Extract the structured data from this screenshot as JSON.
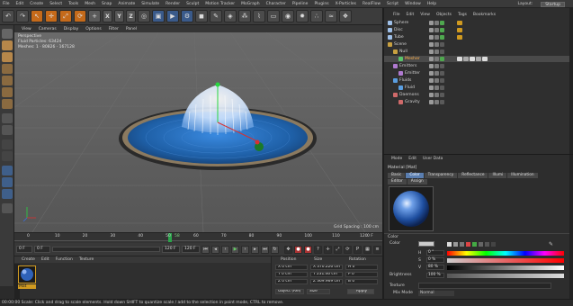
{
  "menubar": {
    "items": [
      "File",
      "Edit",
      "Create",
      "Select",
      "Tools",
      "Mesh",
      "Snap",
      "Animate",
      "Simulate",
      "Render",
      "Sculpt",
      "Motion Tracker",
      "MoGraph",
      "Character",
      "Pipeline",
      "Plugins",
      "X-Particles",
      "RealFlow",
      "Script",
      "Window",
      "Help"
    ],
    "layout_label": "Layout:",
    "layout_value": "Startup"
  },
  "toolbar": {
    "undo_glyph": "↶",
    "axis_labels": [
      "X",
      "Y",
      "Z"
    ],
    "glyphs": [
      "↖",
      "✛",
      "⤢",
      "⟳"
    ]
  },
  "viewport": {
    "menu": [
      "View",
      "Cameras",
      "Display",
      "Options",
      "Filter",
      "Panel"
    ],
    "camera_label": "Perspective",
    "stats": [
      "Fluid Particles: 63424",
      "Meshes: 1 · 80826 · 167128"
    ],
    "grid_spacing": "Grid Spacing : 100 cm",
    "colors": {
      "floor": "#5b5b5b",
      "pool": "#1e5fa6",
      "rim": "#2a2a2a",
      "accent": "#1faa3c"
    }
  },
  "timeline": {
    "ticks": [
      "0",
      "10",
      "20",
      "30",
      "40",
      "50",
      "60",
      "70",
      "80",
      "90",
      "100",
      "110",
      "120"
    ],
    "current_frame": "58",
    "end_label": "0 F"
  },
  "transport": {
    "start_field": "0 F",
    "current_field": "0 F",
    "end_field": "120 F",
    "end_field2": "120 F"
  },
  "material_manager": {
    "menu": [
      "Create",
      "Edit",
      "Function",
      "Texture"
    ],
    "material_name": "Mat"
  },
  "coordinates": {
    "headers": [
      "Position",
      "Size",
      "Rotation"
    ],
    "rows": [
      [
        "X  0 cm",
        "X  370.226 cm",
        "H  0 °"
      ],
      [
        "Y  0 cm",
        "Y  231.46 cm",
        "P  0 °"
      ],
      [
        "Z  0 cm",
        "Z  369.969 cm",
        "B  0 °"
      ]
    ],
    "mode_select": "Object (Rel)",
    "size_select": "Size",
    "apply_label": "Apply"
  },
  "status_bar": "00:00:00    Scale: Click and drag to scale elements. Hold down SHIFT to quantize scale / add to the selection in point mode, CTRL to remove.",
  "object_manager": {
    "menu": [
      "File",
      "Edit",
      "View",
      "Objects",
      "Tags",
      "Bookmarks"
    ],
    "objects": [
      {
        "name": "Sphere",
        "indent": 0,
        "color": "#9fc0e8",
        "selected": false
      },
      {
        "name": "Disc",
        "indent": 0,
        "color": "#9fc0e8",
        "selected": false
      },
      {
        "name": "Tube",
        "indent": 0,
        "color": "#9fc0e8",
        "selected": false
      },
      {
        "name": "Scene",
        "indent": 0,
        "color": "#c8a040",
        "selected": false
      },
      {
        "name": "Null",
        "indent": 1,
        "color": "#c8a040",
        "selected": false
      },
      {
        "name": "Mesher",
        "indent": 2,
        "color": "#59c46a",
        "selected": true
      },
      {
        "name": "Emitters",
        "indent": 1,
        "color": "#b07ad0",
        "selected": false
      },
      {
        "name": "Emitter",
        "indent": 2,
        "color": "#b07ad0",
        "selected": false
      },
      {
        "name": "Fluids",
        "indent": 1,
        "color": "#5a9ee0",
        "selected": false
      },
      {
        "name": "Fluid",
        "indent": 2,
        "color": "#5a9ee0",
        "selected": false
      },
      {
        "name": "Daemons",
        "indent": 1,
        "color": "#d06a6a",
        "selected": false
      },
      {
        "name": "Gravity",
        "indent": 2,
        "color": "#d06a6a",
        "selected": false
      }
    ]
  },
  "attributes": {
    "menu": [
      "Mode",
      "Edit",
      "User Data"
    ],
    "title": "Material [Mat]",
    "tabs_row1": [
      "Basic",
      "Color",
      "Transparency",
      "Reflectance",
      "Illumi",
      "Illumination"
    ],
    "active_tab": "Color",
    "tabs_row2": [
      "Editor",
      "Assign"
    ],
    "section": "Color",
    "color_label": "Color",
    "channels": [
      {
        "label": "H",
        "value": "0 °"
      },
      {
        "label": "S",
        "value": "0 %"
      },
      {
        "label": "V",
        "value": "80 %"
      }
    ],
    "brightness_label": "Brightness",
    "brightness_value": "100 %",
    "texture_label": "Texture",
    "mix_label": "Mix Mode",
    "mix_value": "Normal",
    "mix_strength_label": "Mix Strength",
    "mix_strength_value": "100 %"
  }
}
